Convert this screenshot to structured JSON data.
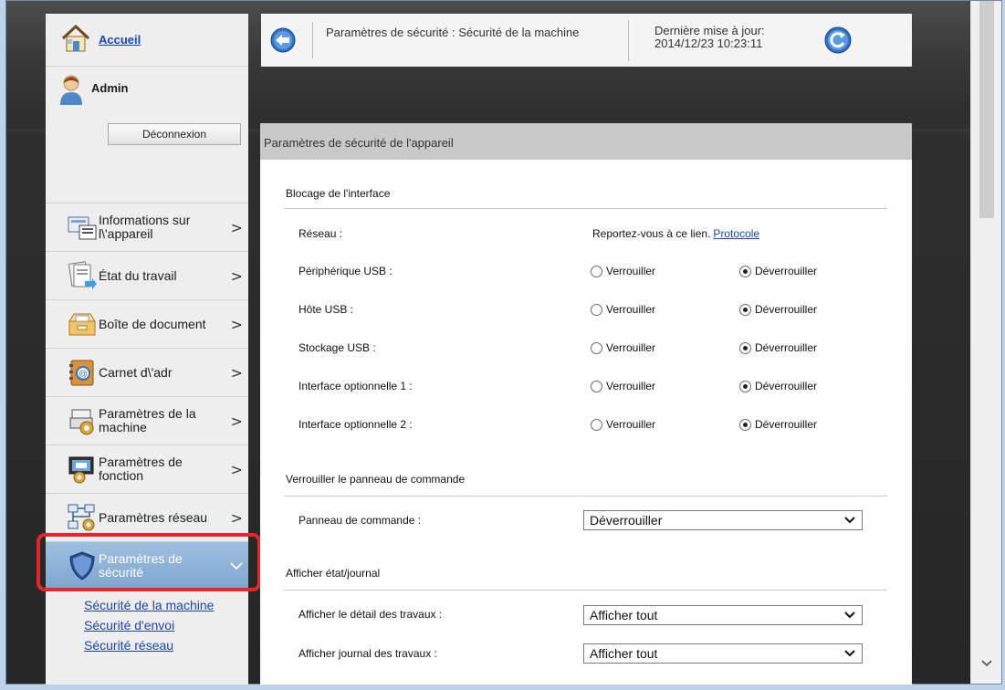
{
  "sidebar": {
    "home_label": "Accueil",
    "user_name": "Admin",
    "logout_label": "Déconnexion",
    "items": [
      {
        "label": "Informations sur l\\'appareil",
        "icon": "device-info-icon"
      },
      {
        "label": "État du travail",
        "icon": "job-status-icon"
      },
      {
        "label": "Boîte de document",
        "icon": "document-box-icon"
      },
      {
        "label": "Carnet d\\'adr",
        "icon": "address-book-icon"
      },
      {
        "label": "Paramètres de la machine",
        "icon": "machine-settings-icon"
      },
      {
        "label": "Paramètres de fonction",
        "icon": "function-settings-icon"
      },
      {
        "label": "Paramètres réseau",
        "icon": "network-settings-icon"
      },
      {
        "label": "Paramètres de sécurité",
        "icon": "security-shield-icon",
        "active": true
      }
    ],
    "sub_items": [
      "Sécurité de la machine",
      "Sécurité d'envoi",
      "Sécurité réseau"
    ]
  },
  "header": {
    "title": "Paramètres de sécurité : Sécurité de la machine",
    "update_label": "Dernière mise à jour:",
    "update_time": "2014/12/23 10:23:11"
  },
  "panel": {
    "title": "Paramètres de sécurité de l'appareil",
    "section_interface": "Blocage de l'interface",
    "network_label": "Réseau :",
    "network_text": "Reportez-vous à ce lien.",
    "network_link": "Protocole",
    "lock_label": "Verrouiller",
    "unlock_label": "Déverrouiller",
    "interfaces": [
      {
        "label": "Périphérique USB :",
        "value": "Déverrouiller"
      },
      {
        "label": "Hôte USB :",
        "value": "Déverrouiller"
      },
      {
        "label": "Stockage USB :",
        "value": "Déverrouiller"
      },
      {
        "label": "Interface optionnelle 1 :",
        "value": "Déverrouiller"
      },
      {
        "label": "Interface optionnelle 2 :",
        "value": "Déverrouiller"
      }
    ],
    "section_panel": "Verrouiller le panneau de commande",
    "panel_label": "Panneau de commande :",
    "panel_value": "Déverrouiller",
    "section_status": "Afficher état/journal",
    "job_detail_label": "Afficher le détail des travaux :",
    "job_detail_value": "Afficher tout",
    "job_log_label": "Afficher journal des travaux :",
    "job_log_value": "Afficher tout"
  },
  "colors": {
    "accent_blue": "#1542c8",
    "active_nav": "#8fb3d8",
    "highlight_red": "#e8262a"
  }
}
